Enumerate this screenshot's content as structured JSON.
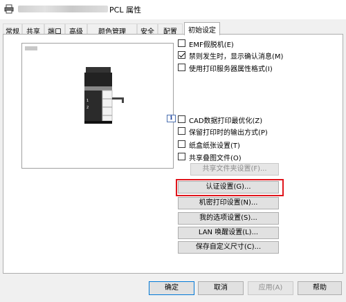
{
  "window": {
    "title_suffix": "PCL 属性"
  },
  "tabs": [
    {
      "label": "常规"
    },
    {
      "label": "共享"
    },
    {
      "label": "端口"
    },
    {
      "label": "高级"
    },
    {
      "label": "颜色管理"
    },
    {
      "label": "安全"
    },
    {
      "label": "配置"
    },
    {
      "label": "初始设定",
      "active": true
    }
  ],
  "options": {
    "emf": {
      "label": "EMF假脱机(E)",
      "checked": false
    },
    "ban_warning": {
      "label": "禁则发生时，显示确认消息(M)",
      "checked": true
    },
    "server_prop": {
      "label": "使用打印服务器属性格式(I)",
      "checked": false
    },
    "cad": {
      "label": "CAD数据打印最优化(Z)",
      "checked": false
    },
    "keep_output": {
      "label": "保留打印时的输出方式(P)",
      "checked": false
    },
    "tray_setting": {
      "label": "纸盒纸张设置(T)",
      "checked": false
    },
    "share_overlay": {
      "label": "共享叠图文件(O)",
      "checked": false
    }
  },
  "buttons": {
    "share_folder": "共享文件夹设置(F)...",
    "auth": "认证设置(G)...",
    "secure_print": "机密打印设置(N)...",
    "my_options": "我的选项设置(S)...",
    "lan_wake": "LAN 唤醒设置(L)...",
    "custom_size": "保存自定义尺寸(C)..."
  },
  "footer": {
    "ok": "确定",
    "cancel": "取消",
    "apply": "应用(A)",
    "help": "帮助"
  },
  "icons": {
    "title": "printer-icon",
    "info": "info-icon"
  },
  "colors": {
    "highlight": "#e0141b"
  }
}
